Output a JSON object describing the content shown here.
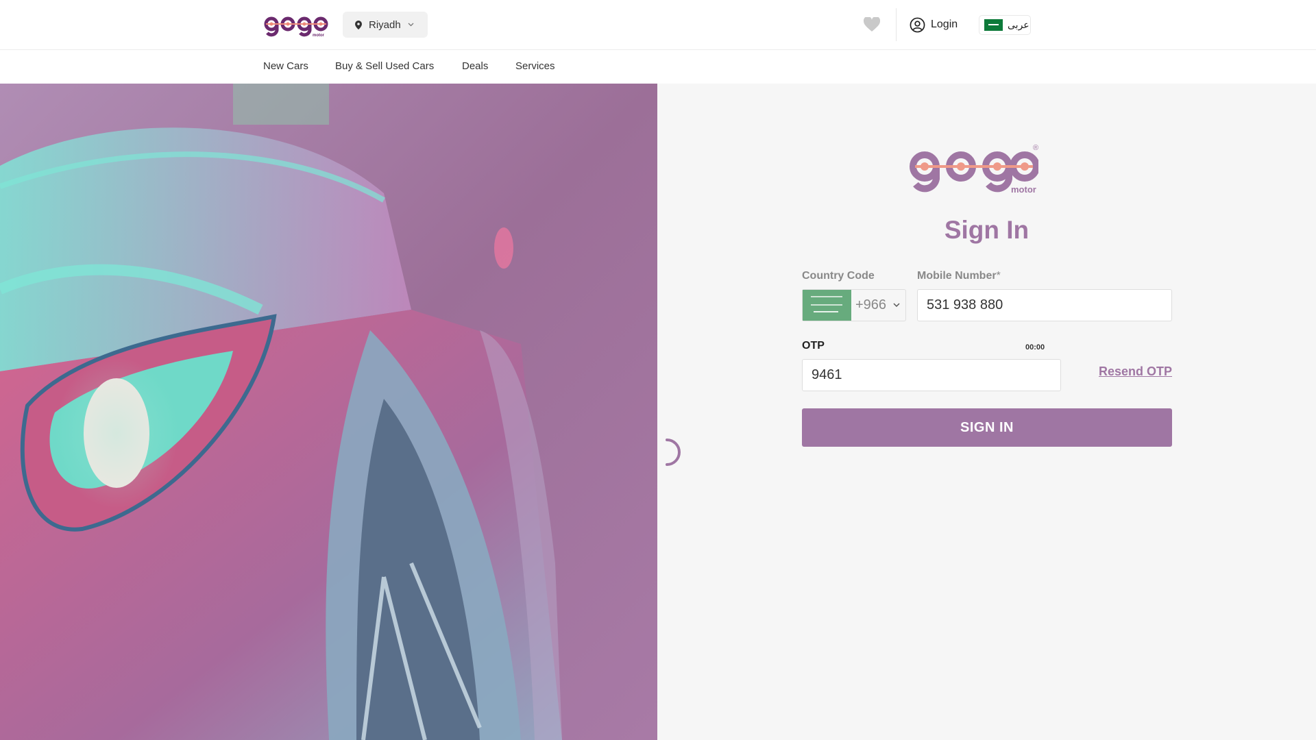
{
  "header": {
    "logo_text": "gogo",
    "logo_sub": "motor",
    "city": "Riyadh",
    "login_label": "Login",
    "language_label": "عربى"
  },
  "nav": {
    "items": [
      {
        "label": "New Cars"
      },
      {
        "label": "Buy & Sell Used Cars"
      },
      {
        "label": "Deals"
      },
      {
        "label": "Services"
      }
    ]
  },
  "signin": {
    "logo_text": "gogo",
    "logo_sub": "motor",
    "logo_mark": "®",
    "title": "Sign In",
    "country_code_label": "Country Code",
    "country_code_value": "+966",
    "mobile_label": "Mobile Number",
    "mobile_required_mark": "*",
    "mobile_value": "531 938 880",
    "otp_label": "OTP",
    "otp_timer": "00:00",
    "otp_value": "9461",
    "resend_label": "Resend OTP",
    "submit_label": "SIGN IN"
  },
  "icons": {
    "location": "pin-icon",
    "dropdown": "chevron-down-icon",
    "wishlist": "heart-icon",
    "account": "user-circle-icon",
    "flag": "saudi-flag-icon",
    "loading": "spinner-icon"
  },
  "colors": {
    "brand": "#9f76a3",
    "brand_dark": "#6b2a6e",
    "accent": "#ef8a78",
    "panel_bg": "#f6f6f6"
  }
}
